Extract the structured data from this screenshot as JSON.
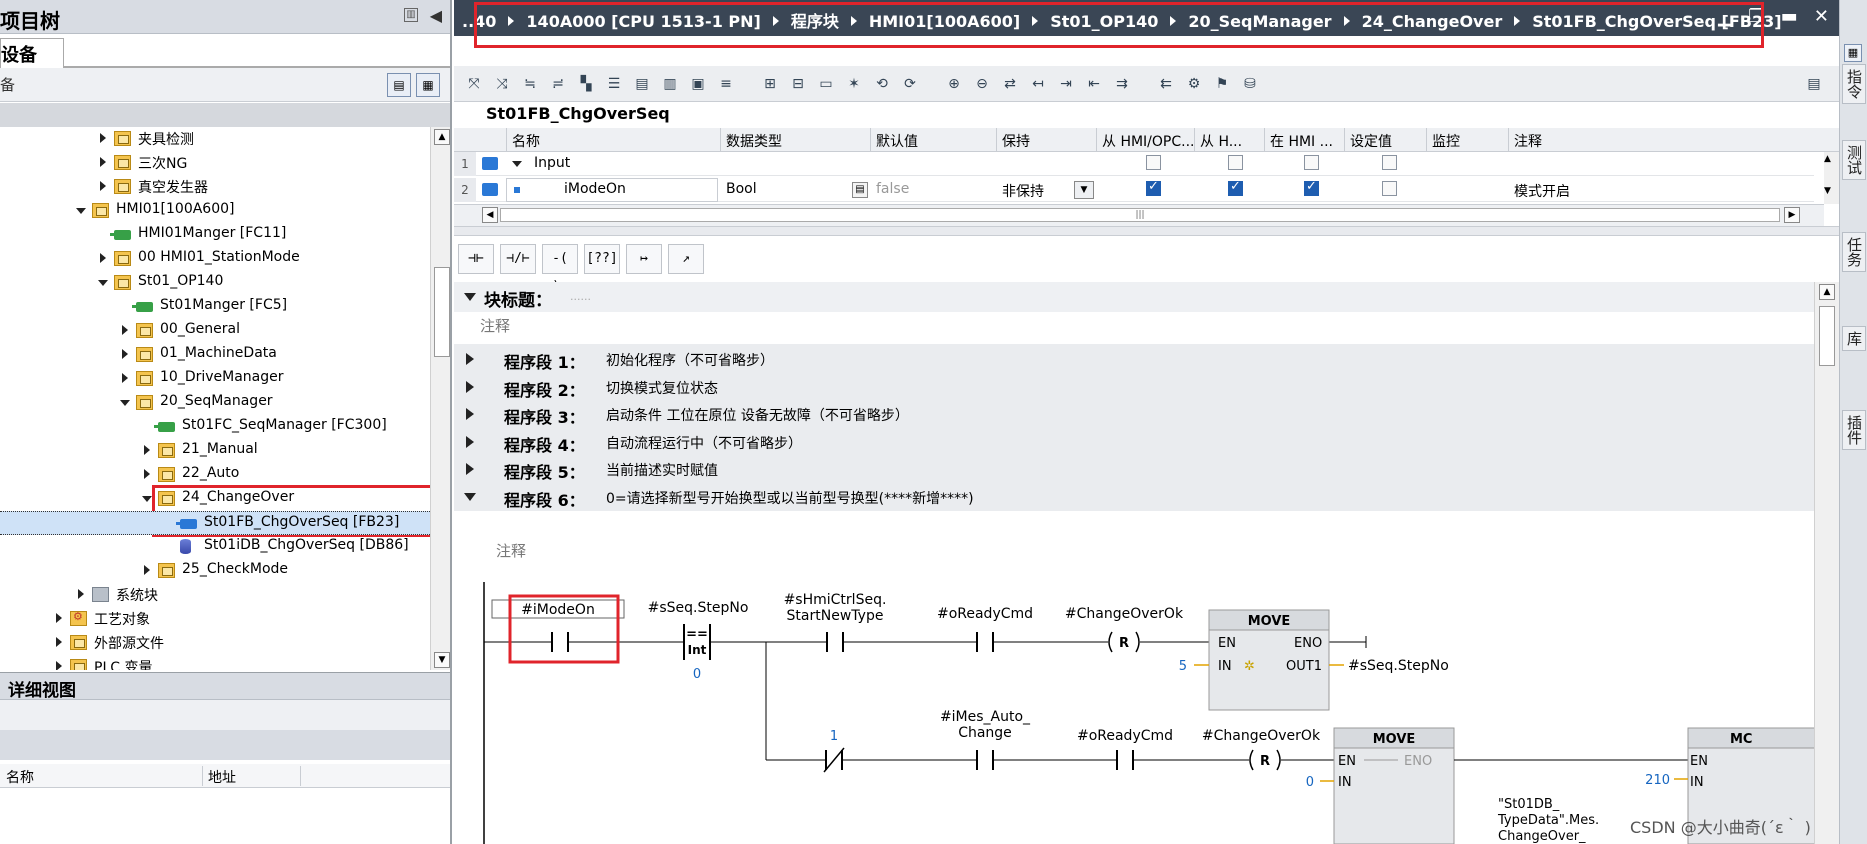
{
  "left_panel": {
    "title": "项目树",
    "tab": "设备",
    "sub_label": "备",
    "tree": [
      {
        "label": "夹具检测",
        "indent": 5,
        "twisty": "r",
        "icon": "folder"
      },
      {
        "label": "三次NG",
        "indent": 5,
        "twisty": "r",
        "icon": "folder"
      },
      {
        "label": "真空发生器",
        "indent": 5,
        "twisty": "r",
        "icon": "folder"
      },
      {
        "label": "HMI01[100A600]",
        "indent": 4,
        "twisty": "d",
        "icon": "folder"
      },
      {
        "label": "HMI01Manger [FC11]",
        "indent": 5,
        "twisty": "",
        "icon": "fc"
      },
      {
        "label": "00 HMI01_StationMode",
        "indent": 5,
        "twisty": "r",
        "icon": "folder"
      },
      {
        "label": "St01_OP140",
        "indent": 5,
        "twisty": "d",
        "icon": "folder"
      },
      {
        "label": "St01Manger [FC5]",
        "indent": 6,
        "twisty": "",
        "icon": "fc"
      },
      {
        "label": "00_General",
        "indent": 6,
        "twisty": "r",
        "icon": "folder"
      },
      {
        "label": "01_MachineData",
        "indent": 6,
        "twisty": "r",
        "icon": "folder"
      },
      {
        "label": "10_DriveManager",
        "indent": 6,
        "twisty": "r",
        "icon": "folder"
      },
      {
        "label": "20_SeqManager",
        "indent": 6,
        "twisty": "d",
        "icon": "folder"
      },
      {
        "label": "St01FC_SeqManager [FC300]",
        "indent": 7,
        "twisty": "",
        "icon": "fc"
      },
      {
        "label": "21_Manual",
        "indent": 7,
        "twisty": "r",
        "icon": "folder"
      },
      {
        "label": "22_Auto",
        "indent": 7,
        "twisty": "r",
        "icon": "folder"
      },
      {
        "label": "24_ChangeOver",
        "indent": 7,
        "twisty": "d",
        "icon": "folder"
      },
      {
        "label": "St01FB_ChgOverSeq [FB23]",
        "indent": 8,
        "twisty": "",
        "icon": "fb",
        "selected": true
      },
      {
        "label": "St01iDB_ChgOverSeq [DB86]",
        "indent": 8,
        "twisty": "",
        "icon": "db"
      },
      {
        "label": "25_CheckMode",
        "indent": 7,
        "twisty": "r",
        "icon": "folder"
      },
      {
        "label": "系统块",
        "indent": 4,
        "twisty": "r",
        "icon": "sys"
      },
      {
        "label": "工艺对象",
        "indent": 3,
        "twisty": "r",
        "icon": "tech"
      },
      {
        "label": "外部源文件",
        "indent": 3,
        "twisty": "r",
        "icon": "folder"
      },
      {
        "label": "PLC 变量",
        "indent": 3,
        "twisty": "r",
        "icon": "folder"
      }
    ],
    "detail_title": "详细视图",
    "detail_cols": [
      "名称",
      "地址"
    ]
  },
  "breadcrumb": [
    "..40",
    "140A000 [CPU 1513-1 PN]",
    "程序块",
    "HMI01[100A600]",
    "St01_OP140",
    "20_SeqManager",
    "24_ChangeOver",
    "St01FB_ChgOverSeq [FB23]"
  ],
  "block_name": "St01FB_ChgOverSeq",
  "interface": {
    "headers": [
      "名称",
      "数据类型",
      "默认值",
      "保持",
      "从 HMI/OPC...",
      "从 H...",
      "在 HMI ...",
      "设定值",
      "监控",
      "注释"
    ],
    "rows": [
      {
        "num": "1",
        "name": "Input",
        "type": "",
        "default": "",
        "retain": "",
        "hmi1": false,
        "hmi2": false,
        "hmi3": false,
        "setpoint": false,
        "comment": ""
      },
      {
        "num": "2",
        "name": "iModeOn",
        "type": "Bool",
        "default": "false",
        "retain": "非保持",
        "hmi1": true,
        "hmi2": true,
        "hmi3": true,
        "setpoint": false,
        "comment": "模式开启"
      }
    ]
  },
  "ladder_buttons": [
    "⊣⊢",
    "⊣/⊢",
    "-( )-",
    "[??]",
    "↦",
    "↗"
  ],
  "block_title_label": "块标题：",
  "block_title_dots": "......",
  "block_comment": "注释",
  "segments": [
    {
      "label": "程序段 1：",
      "title": "初始化程序（不可省略步）"
    },
    {
      "label": "程序段 2：",
      "title": "切换模式复位状态"
    },
    {
      "label": "程序段 3：",
      "title": "启动条件 工位在原位 设备无故障（不可省略步）"
    },
    {
      "label": "程序段 4：",
      "title": "自动流程运行中（不可省略步）"
    },
    {
      "label": "程序段 5：",
      "title": "当前描述实时赋值"
    },
    {
      "label": "程序段 6：",
      "title": "0=请选择新型号开始换型或以当前型号换型(****新增****)"
    }
  ],
  "segment_comment": "注释",
  "ladder": {
    "c1": "#iModeOn",
    "cmp_var": "#sSeq.StepNo",
    "cmp_op": "==",
    "cmp_type": "Int",
    "cmp_val": "0",
    "c3a": "#sHmiCtrlSeq.",
    "c3b": "StartNewType",
    "c4": "#oReadyCmd",
    "coil1": "#ChangeOverOk",
    "coil_r": "R",
    "move": "MOVE",
    "en": "EN",
    "eno": "ENO",
    "in": "IN",
    "out1": "OUT1",
    "in_val1": "5",
    "out_var1": "#sSeq.StepNo",
    "nc_val": "1",
    "c5a": "#iMes_Auto_",
    "c5b": "Change",
    "in_val2": "0",
    "in_val3": "210",
    "mc": "MC",
    "db1": "\"St01DB_",
    "db2": "TypeData\".Mes.",
    "db3": "ChangeOver_"
  },
  "right_tabs": [
    "指令",
    "测试",
    "任务",
    "库",
    "插件"
  ],
  "watermark": "CSDN @大小曲奇(´ε｀ )"
}
